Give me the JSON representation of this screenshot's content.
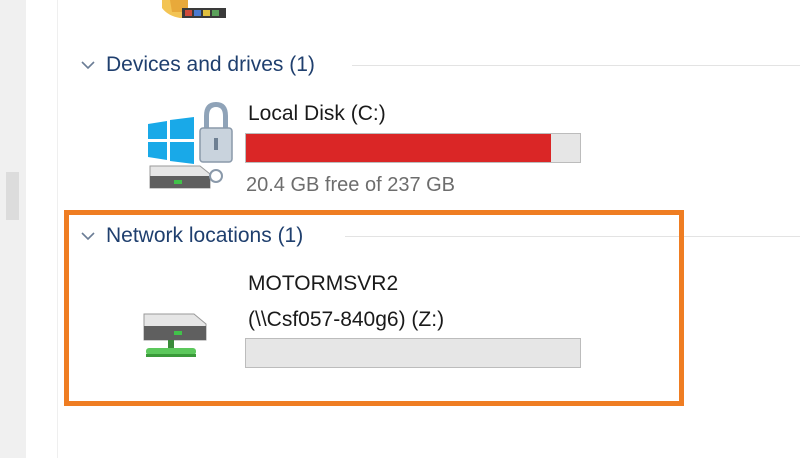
{
  "explorer": {
    "groups": [
      {
        "label": "Devices and drives (1)",
        "items": [
          {
            "name": "Local Disk (C:)",
            "icon": "windows-drive-lock-icon",
            "used_fraction": 0.914,
            "fill_color": "#da2626",
            "free_text": "20.4 GB free of 237 GB"
          }
        ]
      },
      {
        "label": "Network locations (1)",
        "items": [
          {
            "name_line1": "MOTORMSVR2",
            "name_line2": "(\\\\Csf057-840g6) (Z:)",
            "icon": "network-drive-icon",
            "used_fraction": 0
          }
        ]
      }
    ]
  },
  "annotation": {
    "highlight_color": "#ef7d22"
  }
}
